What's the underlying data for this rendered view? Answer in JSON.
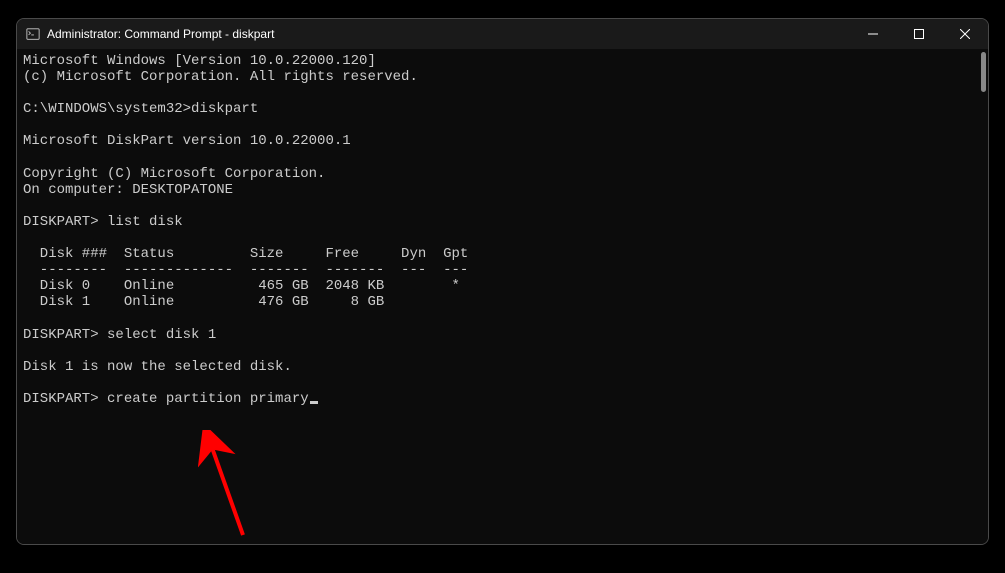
{
  "titlebar": {
    "title": "Administrator: Command Prompt - diskpart"
  },
  "terminal": {
    "lines": [
      "Microsoft Windows [Version 10.0.22000.120]",
      "(c) Microsoft Corporation. All rights reserved.",
      "",
      "C:\\WINDOWS\\system32>diskpart",
      "",
      "Microsoft DiskPart version 10.0.22000.1",
      "",
      "Copyright (C) Microsoft Corporation.",
      "On computer: DESKTOPATONE",
      "",
      "DISKPART> list disk",
      "",
      "  Disk ###  Status         Size     Free     Dyn  Gpt",
      "  --------  -------------  -------  -------  ---  ---",
      "  Disk 0    Online          465 GB  2048 KB        *",
      "  Disk 1    Online          476 GB     8 GB",
      "",
      "DISKPART> select disk 1",
      "",
      "Disk 1 is now the selected disk.",
      "",
      "DISKPART> create partition primary"
    ]
  }
}
